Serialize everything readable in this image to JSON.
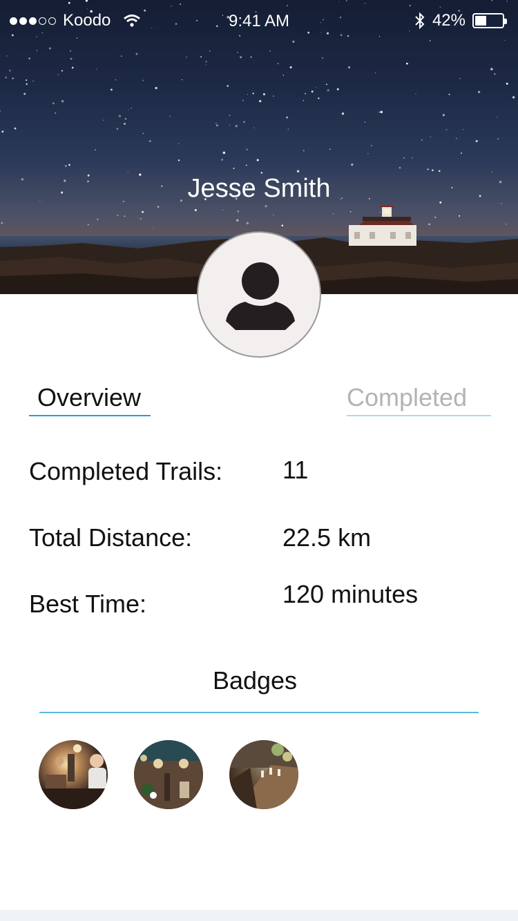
{
  "status_bar": {
    "carrier": "Koodo",
    "time": "9:41 AM",
    "battery_percent": "42%",
    "battery_level": 0.42,
    "signal_bars_filled": 3,
    "signal_bars_total": 5,
    "icons": [
      "wifi-icon",
      "bluetooth-icon",
      "battery-icon"
    ]
  },
  "profile": {
    "name": "Jesse Smith",
    "avatar_icon": "user-silhouette-icon"
  },
  "tabs": [
    {
      "label": "Overview",
      "active": true
    },
    {
      "label": "Completed",
      "active": false
    }
  ],
  "stats": [
    {
      "label": "Completed Trails:",
      "value": "11"
    },
    {
      "label": "Total Distance:",
      "value": "22.5 km"
    },
    {
      "label": "Best Time:",
      "value": "120 minutes"
    }
  ],
  "badges": {
    "title": "Badges"
  },
  "colors": {
    "accent": "#1ea0d2",
    "inactive_tab_text": "#b3b3b3",
    "inactive_tab_underline": "#aadbe9"
  }
}
